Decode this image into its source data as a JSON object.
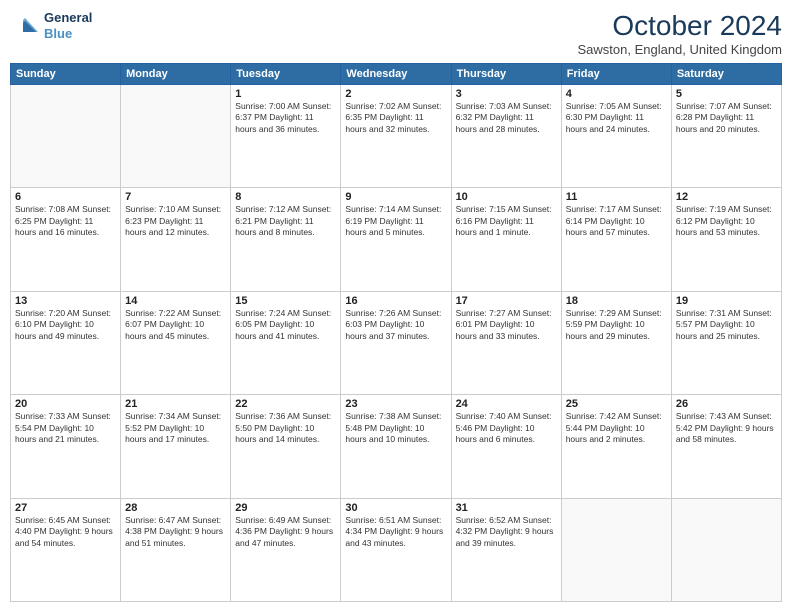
{
  "header": {
    "logo_line1": "General",
    "logo_line2": "Blue",
    "title": "October 2024",
    "location": "Sawston, England, United Kingdom"
  },
  "days_of_week": [
    "Sunday",
    "Monday",
    "Tuesday",
    "Wednesday",
    "Thursday",
    "Friday",
    "Saturday"
  ],
  "weeks": [
    [
      {
        "day": "",
        "info": ""
      },
      {
        "day": "",
        "info": ""
      },
      {
        "day": "1",
        "info": "Sunrise: 7:00 AM\nSunset: 6:37 PM\nDaylight: 11 hours and 36 minutes."
      },
      {
        "day": "2",
        "info": "Sunrise: 7:02 AM\nSunset: 6:35 PM\nDaylight: 11 hours and 32 minutes."
      },
      {
        "day": "3",
        "info": "Sunrise: 7:03 AM\nSunset: 6:32 PM\nDaylight: 11 hours and 28 minutes."
      },
      {
        "day": "4",
        "info": "Sunrise: 7:05 AM\nSunset: 6:30 PM\nDaylight: 11 hours and 24 minutes."
      },
      {
        "day": "5",
        "info": "Sunrise: 7:07 AM\nSunset: 6:28 PM\nDaylight: 11 hours and 20 minutes."
      }
    ],
    [
      {
        "day": "6",
        "info": "Sunrise: 7:08 AM\nSunset: 6:25 PM\nDaylight: 11 hours and 16 minutes."
      },
      {
        "day": "7",
        "info": "Sunrise: 7:10 AM\nSunset: 6:23 PM\nDaylight: 11 hours and 12 minutes."
      },
      {
        "day": "8",
        "info": "Sunrise: 7:12 AM\nSunset: 6:21 PM\nDaylight: 11 hours and 8 minutes."
      },
      {
        "day": "9",
        "info": "Sunrise: 7:14 AM\nSunset: 6:19 PM\nDaylight: 11 hours and 5 minutes."
      },
      {
        "day": "10",
        "info": "Sunrise: 7:15 AM\nSunset: 6:16 PM\nDaylight: 11 hours and 1 minute."
      },
      {
        "day": "11",
        "info": "Sunrise: 7:17 AM\nSunset: 6:14 PM\nDaylight: 10 hours and 57 minutes."
      },
      {
        "day": "12",
        "info": "Sunrise: 7:19 AM\nSunset: 6:12 PM\nDaylight: 10 hours and 53 minutes."
      }
    ],
    [
      {
        "day": "13",
        "info": "Sunrise: 7:20 AM\nSunset: 6:10 PM\nDaylight: 10 hours and 49 minutes."
      },
      {
        "day": "14",
        "info": "Sunrise: 7:22 AM\nSunset: 6:07 PM\nDaylight: 10 hours and 45 minutes."
      },
      {
        "day": "15",
        "info": "Sunrise: 7:24 AM\nSunset: 6:05 PM\nDaylight: 10 hours and 41 minutes."
      },
      {
        "day": "16",
        "info": "Sunrise: 7:26 AM\nSunset: 6:03 PM\nDaylight: 10 hours and 37 minutes."
      },
      {
        "day": "17",
        "info": "Sunrise: 7:27 AM\nSunset: 6:01 PM\nDaylight: 10 hours and 33 minutes."
      },
      {
        "day": "18",
        "info": "Sunrise: 7:29 AM\nSunset: 5:59 PM\nDaylight: 10 hours and 29 minutes."
      },
      {
        "day": "19",
        "info": "Sunrise: 7:31 AM\nSunset: 5:57 PM\nDaylight: 10 hours and 25 minutes."
      }
    ],
    [
      {
        "day": "20",
        "info": "Sunrise: 7:33 AM\nSunset: 5:54 PM\nDaylight: 10 hours and 21 minutes."
      },
      {
        "day": "21",
        "info": "Sunrise: 7:34 AM\nSunset: 5:52 PM\nDaylight: 10 hours and 17 minutes."
      },
      {
        "day": "22",
        "info": "Sunrise: 7:36 AM\nSunset: 5:50 PM\nDaylight: 10 hours and 14 minutes."
      },
      {
        "day": "23",
        "info": "Sunrise: 7:38 AM\nSunset: 5:48 PM\nDaylight: 10 hours and 10 minutes."
      },
      {
        "day": "24",
        "info": "Sunrise: 7:40 AM\nSunset: 5:46 PM\nDaylight: 10 hours and 6 minutes."
      },
      {
        "day": "25",
        "info": "Sunrise: 7:42 AM\nSunset: 5:44 PM\nDaylight: 10 hours and 2 minutes."
      },
      {
        "day": "26",
        "info": "Sunrise: 7:43 AM\nSunset: 5:42 PM\nDaylight: 9 hours and 58 minutes."
      }
    ],
    [
      {
        "day": "27",
        "info": "Sunrise: 6:45 AM\nSunset: 4:40 PM\nDaylight: 9 hours and 54 minutes."
      },
      {
        "day": "28",
        "info": "Sunrise: 6:47 AM\nSunset: 4:38 PM\nDaylight: 9 hours and 51 minutes."
      },
      {
        "day": "29",
        "info": "Sunrise: 6:49 AM\nSunset: 4:36 PM\nDaylight: 9 hours and 47 minutes."
      },
      {
        "day": "30",
        "info": "Sunrise: 6:51 AM\nSunset: 4:34 PM\nDaylight: 9 hours and 43 minutes."
      },
      {
        "day": "31",
        "info": "Sunrise: 6:52 AM\nSunset: 4:32 PM\nDaylight: 9 hours and 39 minutes."
      },
      {
        "day": "",
        "info": ""
      },
      {
        "day": "",
        "info": ""
      }
    ]
  ]
}
